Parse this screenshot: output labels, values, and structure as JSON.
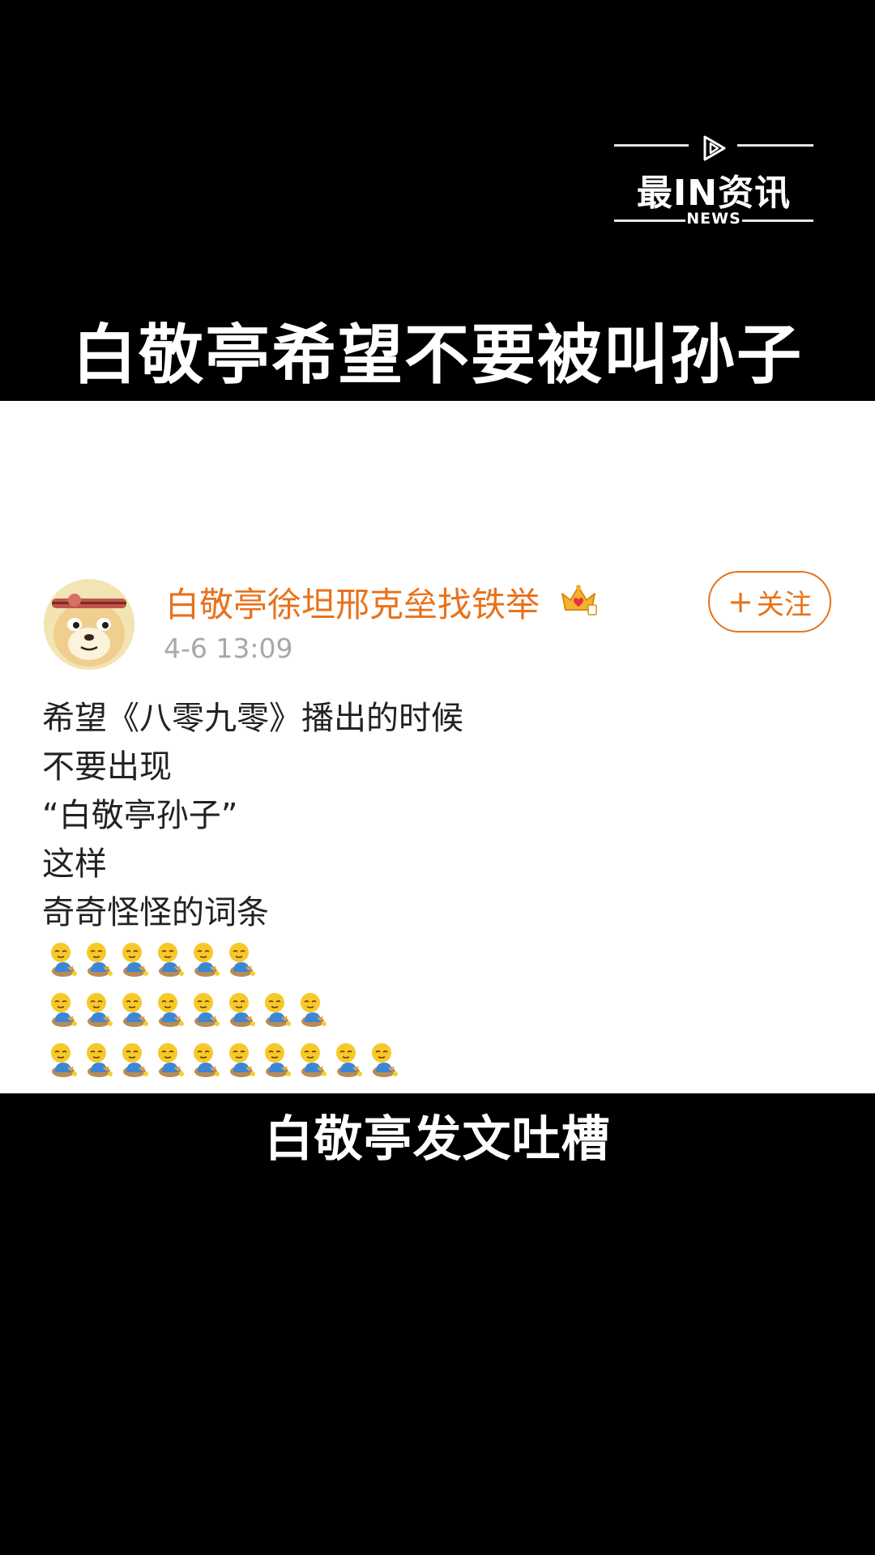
{
  "logo": {
    "brand": "最IN资讯",
    "sub": "NEWS"
  },
  "headline": "白敬亭希望不要被叫孙子",
  "post": {
    "username": "白敬亭徐坦邢克垒找铁举",
    "timestamp": "4-6 13:09",
    "follow_label": "关注",
    "content_lines": [
      "希望《八零九零》播出的时候",
      "不要出现",
      "“白敬亭孙子”",
      "这样",
      "奇奇怪怪的词条"
    ],
    "emoji_name": "pray-emoji",
    "emoji_rows": [
      6,
      8,
      10
    ]
  },
  "subtitle": "白敬亭发文吐槽",
  "colors": {
    "accent": "#e8721b",
    "background": "#000000",
    "panel": "#ffffff",
    "muted": "#a8a8a8"
  }
}
